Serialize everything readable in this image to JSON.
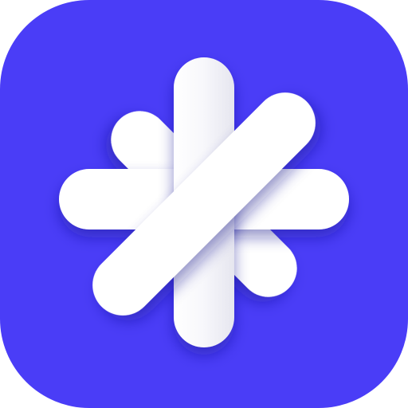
{
  "app_icon": {
    "name": "asterisk-app-icon",
    "background_color": "#4a3df7",
    "glyph": "asterisk-icon",
    "glyph_color": "#ffffff",
    "glyph_shade_color": "#e4e4ee",
    "shadow_color": "#2b1fb8"
  }
}
